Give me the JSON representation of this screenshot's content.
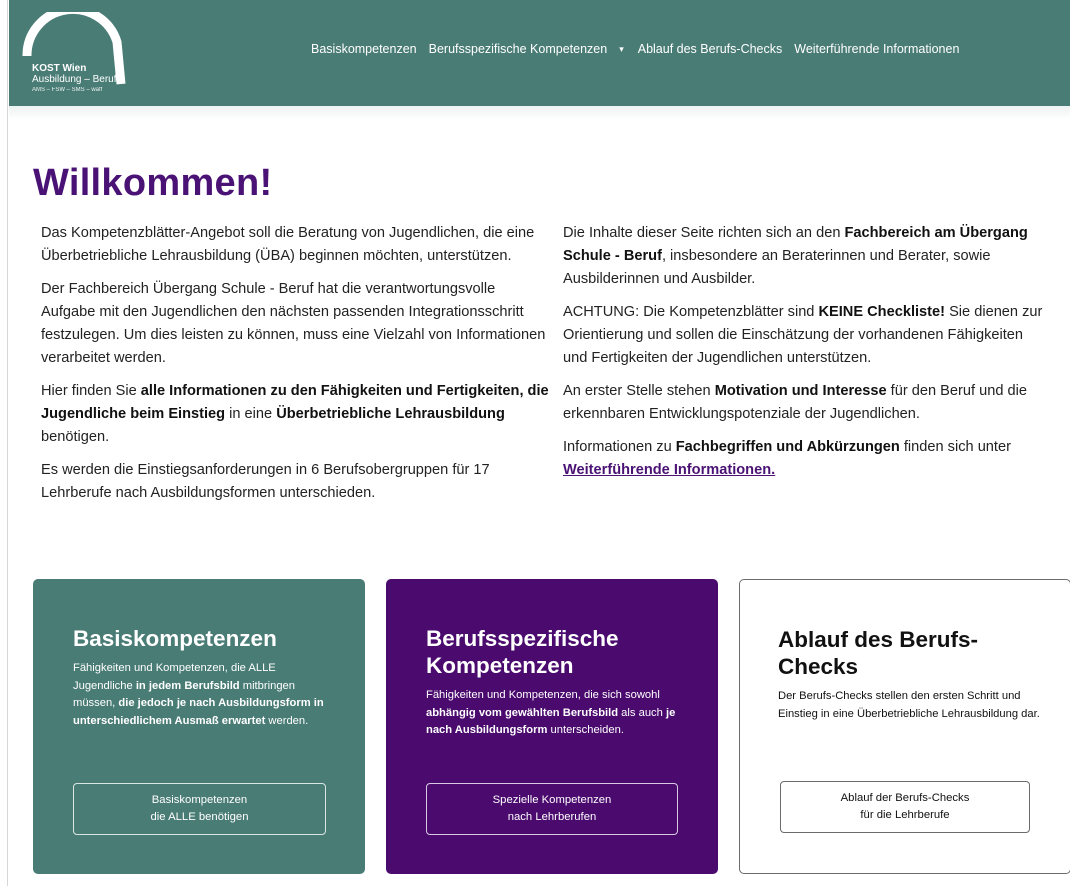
{
  "header": {
    "logo": {
      "line1": "KOST Wien",
      "line2": "Ausbildung – Beruf",
      "line3": "AMS – FSW – SMS – waff"
    },
    "nav": [
      {
        "label": "Basiskompetenzen"
      },
      {
        "label": "Berufsspezifische Kompetenzen",
        "has_dropdown": true
      },
      {
        "label": "Ablauf des Berufs-Checks"
      },
      {
        "label": "Weiterführende Informationen"
      }
    ]
  },
  "main": {
    "title": "Willkommen!",
    "left": {
      "p1": "Das Kompetenzblätter-Angebot soll die Beratung von Jugendlichen, die eine Überbetriebliche Lehrausbildung (ÜBA) beginnen möchten, unterstützen.",
      "p2": "Der Fachbereich Übergang Schule - Beruf hat die verantwortungsvolle Aufgabe mit den Jugendlichen den nächsten passenden Integrationsschritt festzulegen. Um dies leisten zu können, muss eine Vielzahl von Informationen verarbeitet werden.",
      "p3a": "Hier finden Sie ",
      "p3b": "alle Informationen zu den Fähigkeiten und Fertigkeiten, die Jugendliche beim Einstieg",
      "p3c": " in eine ",
      "p3d": "Überbetriebliche Lehrausbildung",
      "p3e": " benötigen.",
      "p4": "Es werden die Einstiegsanforderungen in 6 Berufsobergruppen für 17 Lehrberufe nach Ausbildungsformen unterschieden."
    },
    "right": {
      "p1a": "Die Inhalte dieser Seite richten sich an den ",
      "p1b": "Fachbereich am Übergang Schule - Beruf",
      "p1c": ", insbesondere an Beraterinnen und Berater, sowie Ausbilderinnen und Ausbilder.",
      "p2a": "ACHTUNG: Die Kompetenzblätter sind ",
      "p2b": "KEINE Checkliste!",
      "p2c": " Sie dienen zur Orientierung und sollen die Einschätzung der vorhandenen Fähigkeiten und Fertigkeiten der Jugendlichen unterstützen.",
      "p3a": "An erster Stelle stehen ",
      "p3b": "Motivation und Interesse",
      "p3c": " für den Beruf und die erkennbaren Entwicklungspotenziale der Jugendlichen.",
      "p4a": "Informationen zu ",
      "p4b": "Fachbegriffen und Abkürzungen",
      "p4c": " finden sich unter ",
      "p4_link": "Weiterführende Informationen."
    }
  },
  "cards": [
    {
      "title": "Basiskompetenzen",
      "d1": "Fähigkeiten und Kompetenzen, die ALLE Jugendliche ",
      "d2": "in jedem Berufsbild",
      "d3": " mitbringen müssen, ",
      "d4": "die jedoch je nach Ausbildungsform in unterschiedlichem Ausmaß erwartet",
      "d5": " werden.",
      "btn1": "Basiskompetenzen",
      "btn2": "die ALLE benötigen"
    },
    {
      "title": "Berufsspezifische Kompetenzen",
      "d1": "Fähigkeiten und Kompetenzen, die sich sowohl ",
      "d2": "abhängig vom gewählten Berufsbild",
      "d3": " als auch ",
      "d4": "je nach Ausbildungsform",
      "d5": " unterscheiden.",
      "btn1": "Spezielle Kompetenzen",
      "btn2": "nach Lehrberufen"
    },
    {
      "title": "Ablauf des Berufs-Checks",
      "desc": "Der Berufs-Checks stellen den ersten Schritt und Einstieg in eine Überbetriebliche Lehrausbildung dar.",
      "btn1": "Ablauf der Berufs-Checks",
      "btn2": "für die Lehrberufe"
    }
  ],
  "colors": {
    "header": "#4a7c76",
    "title": "#4a1275",
    "card_purple": "#4a0a6e",
    "card_teal": "#4a7c76"
  }
}
